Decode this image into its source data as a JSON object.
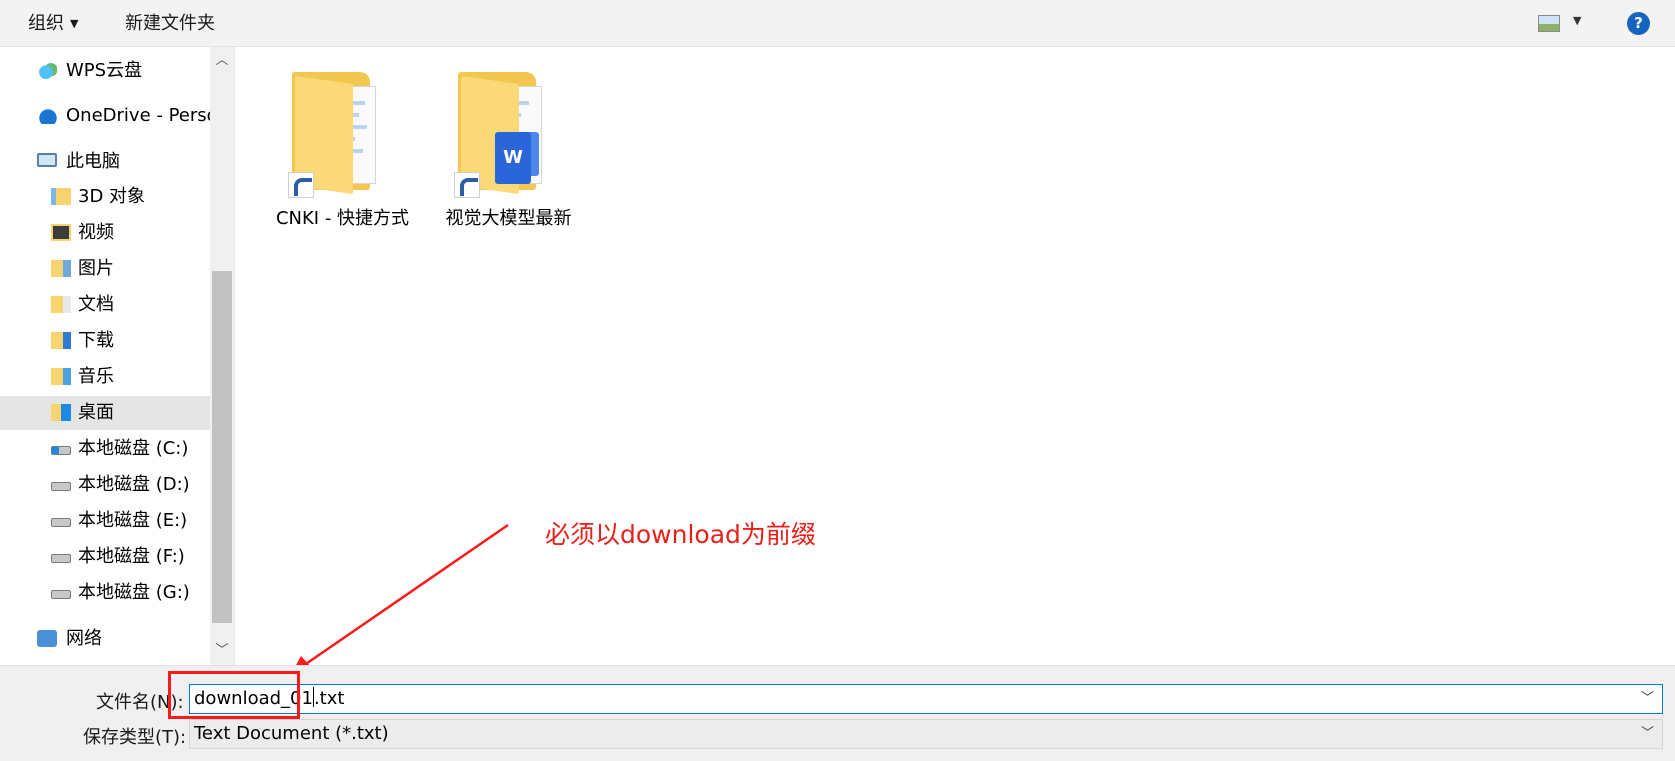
{
  "toolbar": {
    "organize_label": "组织",
    "new_folder_label": "新建文件夹",
    "view_icon": "view-options-icon",
    "help_label": "?"
  },
  "nav": {
    "items": [
      {
        "label": "WPS云盘",
        "icon": "wps-cloud-icon"
      },
      {
        "label": "OneDrive - Perso",
        "icon": "onedrive-icon"
      },
      {
        "label": "此电脑",
        "icon": "this-pc-icon"
      },
      {
        "label": "3D 对象",
        "icon": "3d-objects-icon"
      },
      {
        "label": "视频",
        "icon": "videos-icon"
      },
      {
        "label": "图片",
        "icon": "pictures-icon"
      },
      {
        "label": "文档",
        "icon": "documents-icon"
      },
      {
        "label": "下载",
        "icon": "downloads-icon"
      },
      {
        "label": "音乐",
        "icon": "music-icon"
      },
      {
        "label": "桌面",
        "icon": "desktop-icon",
        "selected": true
      },
      {
        "label": "本地磁盘 (C:)",
        "icon": "drive-c-icon"
      },
      {
        "label": "本地磁盘 (D:)",
        "icon": "drive-icon"
      },
      {
        "label": "本地磁盘 (E:)",
        "icon": "drive-icon"
      },
      {
        "label": "本地磁盘 (F:)",
        "icon": "drive-icon"
      },
      {
        "label": "本地磁盘 (G:)",
        "icon": "drive-icon"
      },
      {
        "label": "网络",
        "icon": "network-icon"
      }
    ]
  },
  "files": [
    {
      "name": "CNKI - 快捷方式",
      "icon": "folder-shortcut-icon"
    },
    {
      "name": "视觉大模型最新",
      "icon": "folder-shortcut-icon"
    }
  ],
  "annotation": {
    "text": "必须以download为前缀",
    "color": "#e8221a"
  },
  "bottom": {
    "filename_label": "文件名(N):",
    "filename_value_before_cursor": "download_01",
    "filename_value_after_cursor": ".txt",
    "filetype_label": "保存类型(T):",
    "filetype_value": "Text Document (*.txt)"
  },
  "colors": {
    "accent": "#0078d7",
    "selection": "#e5e5e5",
    "annotation_red": "#ff1a1a"
  }
}
